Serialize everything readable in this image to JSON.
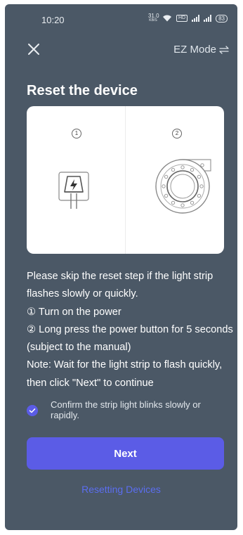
{
  "status_bar": {
    "time": "10:20",
    "speed_value": "31.0",
    "speed_unit": "KB/S",
    "hd_label": "HD",
    "battery": "83"
  },
  "header": {
    "mode_label": "EZ Mode",
    "title": "Reset the device"
  },
  "illustration": {
    "step1_number": "①",
    "step2_number": "②"
  },
  "instructions": {
    "line1": "Please skip the reset step if the light strip flashes slowly or quickly.",
    "line2": "① Turn on the power",
    "line3": "② Long press the power button for 5 seconds (subject to the manual)",
    "line4": "Note: Wait for the light strip to flash quickly, then click \"Next\" to continue"
  },
  "confirm": {
    "checked": true,
    "label": "Confirm the strip light blinks slowly or rapidly."
  },
  "actions": {
    "next_label": "Next",
    "resetting_link": "Resetting Devices"
  },
  "colors": {
    "background": "#4b5866",
    "accent": "#5b5ce6",
    "link": "#5b6ef0"
  }
}
